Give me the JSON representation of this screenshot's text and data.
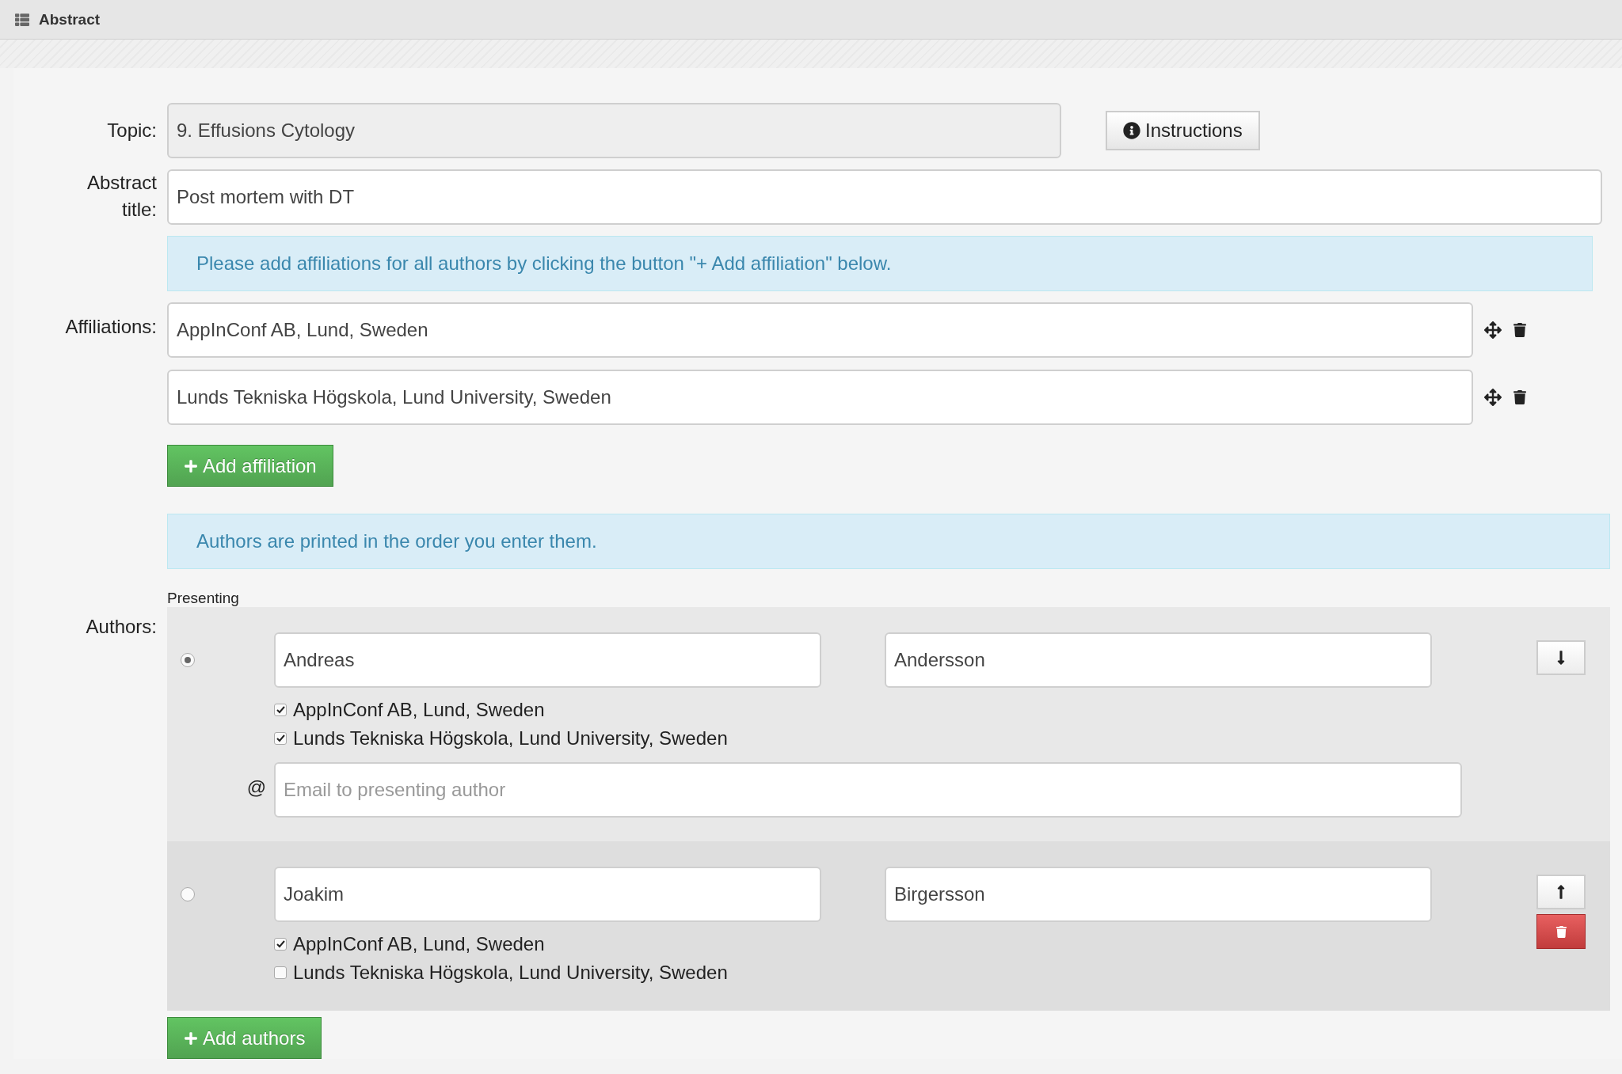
{
  "header": {
    "title": "Abstract"
  },
  "topic": {
    "label": "Topic:",
    "value": "9. Effusions Cytology",
    "disabled": true
  },
  "instructions_button": "Instructions",
  "abstract_title": {
    "label": "Abstract title:",
    "value": "Post mortem with DT"
  },
  "affiliations_notice": "Please add affiliations for all authors by clicking the button \"+ Add affiliation\" below.",
  "affiliations": {
    "label": "Affiliations:",
    "items": [
      {
        "value": "AppInConf AB, Lund, Sweden"
      },
      {
        "value": "Lunds Tekniska Högskola, Lund University, Sweden"
      }
    ]
  },
  "add_affiliation_button": "Add affiliation",
  "authors_notice": "Authors are printed in the order you enter them.",
  "presenting_label": "Presenting",
  "authors_label": "Authors:",
  "authors": [
    {
      "selected": true,
      "first_name": "Andreas",
      "last_name": "Andersson",
      "move_button": {
        "kind": "down"
      },
      "deletable": false,
      "affiliations": [
        {
          "label": "AppInConf AB, Lund, Sweden",
          "checked": true
        },
        {
          "label": "Lunds Tekniska Högskola, Lund University, Sweden",
          "checked": true
        }
      ],
      "email": {
        "at_sign": "@",
        "placeholder": "Email to presenting author"
      }
    },
    {
      "selected": false,
      "first_name": "Joakim",
      "last_name": "Birgersson",
      "move_button": {
        "kind": "up"
      },
      "deletable": true,
      "affiliations": [
        {
          "label": "AppInConf AB, Lund, Sweden",
          "checked": true
        },
        {
          "label": "Lunds Tekniska Högskola, Lund University, Sweden",
          "checked": false
        }
      ]
    }
  ],
  "add_authors_button": "Add authors"
}
